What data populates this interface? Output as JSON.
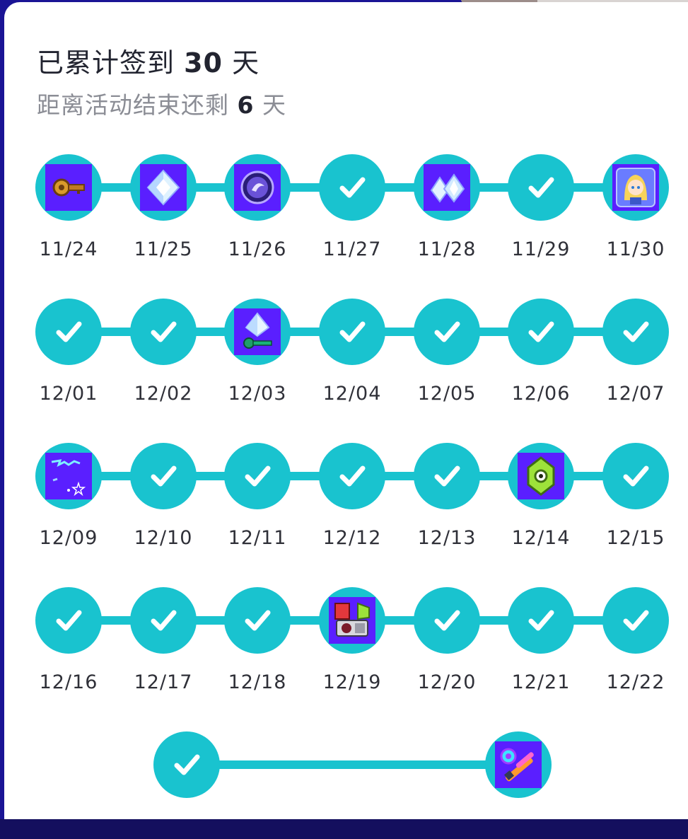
{
  "header": {
    "cumulative_prefix": "已累计签到 ",
    "cumulative_days": "30",
    "cumulative_suffix": " 天",
    "remaining_prefix": "距离活动结束还剩 ",
    "remaining_days": "6",
    "remaining_suffix": " 天"
  },
  "calendar": {
    "rows": [
      {
        "days": [
          {
            "date": "11/24",
            "state": "reward",
            "reward_icon": "key-icon"
          },
          {
            "date": "11/25",
            "state": "reward",
            "reward_icon": "crystal-icon"
          },
          {
            "date": "11/26",
            "state": "reward",
            "reward_icon": "orb-icon"
          },
          {
            "date": "11/27",
            "state": "checked",
            "reward_icon": "check-icon"
          },
          {
            "date": "11/28",
            "state": "reward",
            "reward_icon": "crystals-icon"
          },
          {
            "date": "11/29",
            "state": "checked",
            "reward_icon": "check-icon"
          },
          {
            "date": "11/30",
            "state": "reward",
            "reward_icon": "character-icon"
          }
        ]
      },
      {
        "days": [
          {
            "date": "12/01",
            "state": "checked",
            "reward_icon": "check-icon"
          },
          {
            "date": "12/02",
            "state": "checked",
            "reward_icon": "check-icon"
          },
          {
            "date": "12/03",
            "state": "reward",
            "reward_icon": "crystal-key-icon"
          },
          {
            "date": "12/04",
            "state": "checked",
            "reward_icon": "check-icon"
          },
          {
            "date": "12/05",
            "state": "checked",
            "reward_icon": "check-icon"
          },
          {
            "date": "12/06",
            "state": "checked",
            "reward_icon": "check-icon"
          },
          {
            "date": "12/07",
            "state": "checked",
            "reward_icon": "check-icon"
          }
        ]
      },
      {
        "days": [
          {
            "date": "12/09",
            "state": "reward",
            "reward_icon": "graffiti-icon"
          },
          {
            "date": "12/10",
            "state": "checked",
            "reward_icon": "check-icon"
          },
          {
            "date": "12/11",
            "state": "checked",
            "reward_icon": "check-icon"
          },
          {
            "date": "12/12",
            "state": "checked",
            "reward_icon": "check-icon"
          },
          {
            "date": "12/13",
            "state": "checked",
            "reward_icon": "check-icon"
          },
          {
            "date": "12/14",
            "state": "reward",
            "reward_icon": "green-gem-icon"
          },
          {
            "date": "12/15",
            "state": "checked",
            "reward_icon": "check-icon"
          }
        ]
      },
      {
        "days": [
          {
            "date": "12/16",
            "state": "checked",
            "reward_icon": "check-icon"
          },
          {
            "date": "12/17",
            "state": "checked",
            "reward_icon": "check-icon"
          },
          {
            "date": "12/18",
            "state": "checked",
            "reward_icon": "check-icon"
          },
          {
            "date": "12/19",
            "state": "reward",
            "reward_icon": "gpu-icon"
          },
          {
            "date": "12/20",
            "state": "checked",
            "reward_icon": "check-icon"
          },
          {
            "date": "12/21",
            "state": "checked",
            "reward_icon": "check-icon"
          },
          {
            "date": "12/22",
            "state": "checked",
            "reward_icon": "check-icon"
          }
        ]
      },
      {
        "days": [
          {
            "date": "",
            "state": "checked",
            "reward_icon": "check-icon"
          },
          {
            "date": "",
            "state": "reward",
            "reward_icon": "weapon-icon"
          }
        ]
      }
    ]
  },
  "colors": {
    "accent": "#19c3cf",
    "reward_bg": "#5a1fff",
    "page_bg": "#1a1495",
    "card_bg": "#ffffff",
    "title_text": "#222430",
    "subtitle_text": "#8b8d95"
  }
}
